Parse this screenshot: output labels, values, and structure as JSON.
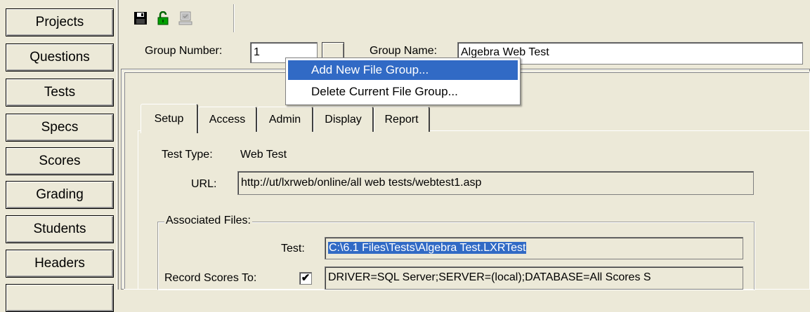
{
  "nav": {
    "items": [
      "Projects",
      "Questions",
      "Tests",
      "Specs",
      "Scores",
      "Grading",
      "Students",
      "Headers"
    ]
  },
  "toolbar": {
    "save_icon": "floppy-disk-icon",
    "unlock_icon": "unlock-icon",
    "preview_icon": "computer-icon"
  },
  "group": {
    "number_label": "Group Number:",
    "number_value": "1",
    "name_label": "Group Name:",
    "name_value": "Algebra Web Test"
  },
  "context_menu": {
    "items": [
      "Add New File Group...",
      "Delete Current File Group..."
    ]
  },
  "tabs": [
    "Setup",
    "Access",
    "Admin",
    "Display",
    "Report"
  ],
  "setup": {
    "test_type_label": "Test Type:",
    "test_type_value": "Web Test",
    "url_label": "URL:",
    "url_value": "http://ut/lxrweb/online/all web tests/webtest1.asp",
    "associated_files_label": "Associated Files:",
    "test_label": "Test:",
    "test_value": "C:\\6.1 Files\\Tests\\Algebra Test.LXRTest",
    "record_scores_label": "Record Scores To:",
    "record_scores_checked": "✔",
    "record_scores_value": "DRIVER=SQL Server;SERVER=(local);DATABASE=All Scores S"
  },
  "colors": {
    "face": "#ece9d8",
    "selection": "#316ac5"
  }
}
